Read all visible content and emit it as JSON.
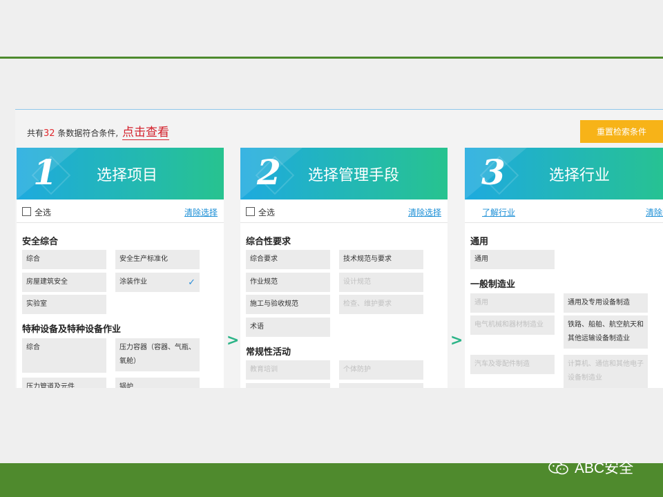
{
  "summary": {
    "prefix": "共有",
    "count": "32",
    "suffix": " 条数据符合条件,",
    "view_link": "点击查看"
  },
  "reset_button": "重置检索条件",
  "panels": {
    "p1": {
      "step": "1",
      "title": "选择项目",
      "select_all": "全选",
      "clear": "清除选择",
      "sections": [
        {
          "title": "安全综合",
          "tags": [
            "综合",
            "安全生产标准化",
            "房屋建筑安全",
            "涂装作业",
            "实验室"
          ]
        },
        {
          "title": "特种设备及特种设备作业",
          "tags": [
            "综合",
            "压力容器（容器、气瓶、氧舱）",
            "压力管道及元件",
            "锅炉"
          ]
        }
      ]
    },
    "p2": {
      "step": "2",
      "title": "选择管理手段",
      "select_all": "全选",
      "clear": "清除选择",
      "sections": [
        {
          "title": "综合性要求",
          "tags": [
            "综合要求",
            "技术规范与要求",
            "作业规范",
            "设计规范",
            "施工与验收规范",
            "检查、维护要求",
            "术语"
          ]
        },
        {
          "title": "常规性活动",
          "tags": [
            "教育培训",
            "个体防护"
          ]
        }
      ]
    },
    "p3": {
      "step": "3",
      "title": "选择行业",
      "learn": "了解行业",
      "clear": "清除选择",
      "sections": [
        {
          "title": "通用",
          "tags": [
            "通用"
          ]
        },
        {
          "title": "一般制造业",
          "tags": [
            "通用",
            "通用及专用设备制造",
            "电气机械和器材制造业",
            "铁路、船舶、航空航天和其他运输设备制造业",
            "汽车及零配件制造",
            "计算机、通信和其他电子设备制造业"
          ]
        }
      ]
    }
  },
  "brand": "ABC安全",
  "icons": {
    "checkbox": "checkbox-icon",
    "check": "checkmark-icon",
    "arrow": "chevron-right-icon",
    "brand": "wechat-icon"
  },
  "colors": {
    "accent_green": "#4e8a2e",
    "button_orange": "#f7b318",
    "link_blue": "#1c8fd6",
    "highlight_red": "#d3202b"
  }
}
